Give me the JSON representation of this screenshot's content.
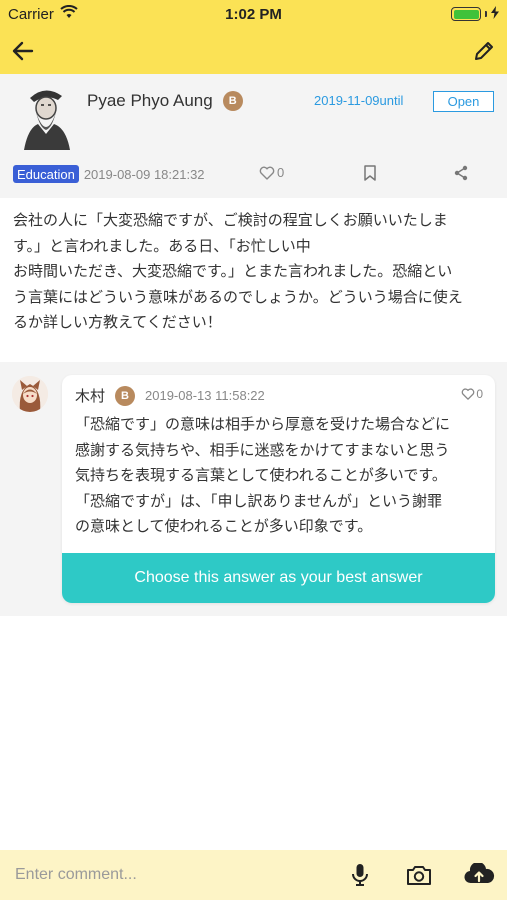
{
  "status_bar": {
    "carrier": "Carrier",
    "time": "1:02 PM"
  },
  "colors": {
    "accent_yellow": "#fbe255",
    "link_blue": "#2b9ae0",
    "teal": "#2ec9c6",
    "tag_blue": "#3a5fd6",
    "badge_brown": "#b88a5e"
  },
  "nav": {
    "back_icon": "arrow-left-icon",
    "edit_icon": "pencil-icon"
  },
  "question": {
    "author": "Pyae Phyo Aung",
    "badge": "B",
    "until_date": "2019-11-09until",
    "status_button": "Open",
    "category": "Education",
    "posted_at": "2019-08-09 18:21:32",
    "likes": "0",
    "body_lines": [
      "会社の人に「大変恐縮ですが、ご検討の程宜しくお願いいたしま",
      "す。」と言われました。ある日、「お忙しい中",
      "お時間いただき、大変恐縮です。」とまた言われました。恐縮とい",
      "う言葉にはどういう意味があるのでしょうか。どういう場合に使え",
      "るか詳しい方教えてください！"
    ]
  },
  "answer": {
    "author": "木村",
    "badge": "B",
    "posted_at": "2019-08-13 11:58:22",
    "likes": "0",
    "body_lines": [
      "「恐縮です」の意味は相手から厚意を受けた場合などに",
      "感謝する気持ちや、相手に迷惑をかけてすまないと思う",
      "気持ちを表現する言葉として使われることが多いです。",
      "「恐縮ですが」は、「申し訳ありませんが」という謝罪",
      "の意味として使われることが多い印象です。"
    ],
    "best_answer_button": "Choose this answer as your best answer"
  },
  "comment_bar": {
    "placeholder": "Enter comment...",
    "mic_icon": "microphone-icon",
    "camera_icon": "camera-icon",
    "upload_icon": "cloud-upload-icon"
  }
}
